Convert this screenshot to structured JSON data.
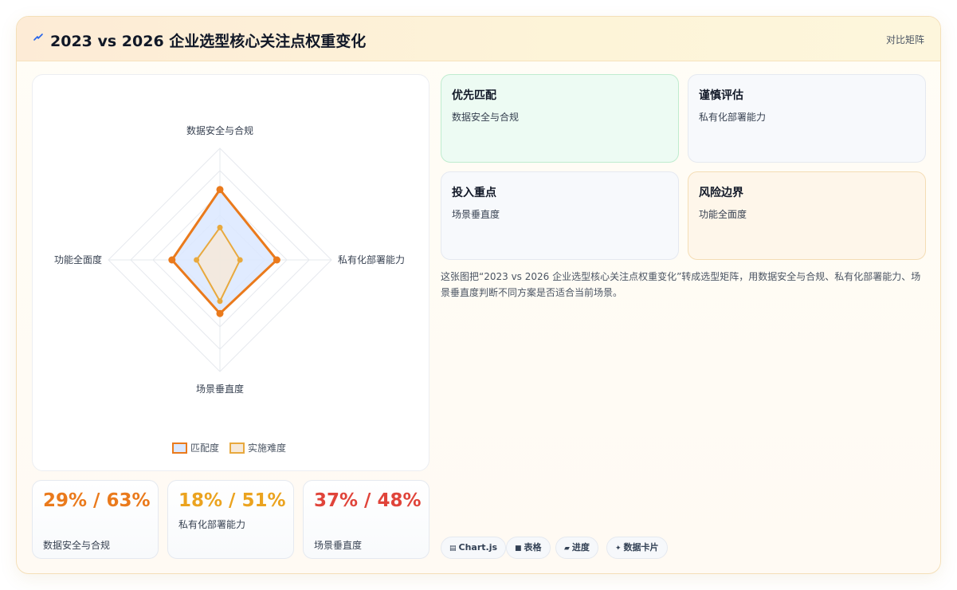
{
  "header": {
    "title": "2023 vs 2026 企业选型核心关注点权重变化",
    "badge": "对比矩阵",
    "icon": "lightning-icon",
    "accent": "#2563eb"
  },
  "chart_data": {
    "type": "radar",
    "title": "",
    "axes": [
      "数据安全与合规",
      "私有化部署能力",
      "场景垂直度",
      "功能全面度"
    ],
    "range": [
      0,
      100
    ],
    "grid": true,
    "legend_position": "bottom-center",
    "series": [
      {
        "name": "匹配度",
        "values": [
          63,
          51,
          48,
          43
        ],
        "color": "#ea7a1c",
        "fill": "#dbe8ff"
      },
      {
        "name": "实施难度",
        "values": [
          29,
          18,
          37,
          21
        ],
        "color": "#e8a93e",
        "fill": "#f6e9d9"
      }
    ]
  },
  "kpis": [
    {
      "value": "29% / 63%",
      "label": "数据安全与合规",
      "color": "#ea7a1c"
    },
    {
      "value": "18% / 51%",
      "label": "私有化部署能力",
      "color": "#eba31f"
    },
    {
      "value": "37% / 48%",
      "label": "场景垂直度",
      "color": "#e0443a"
    }
  ],
  "tiles": [
    {
      "title": "优先匹配",
      "sub": "数据安全与合规",
      "bg": "#edfbf3",
      "border": "#bfeccf"
    },
    {
      "title": "谨慎评估",
      "sub": "私有化部署能力",
      "bg": "#f7f9fc",
      "border": "#e5e9f0"
    },
    {
      "title": "投入重点",
      "sub": "场景垂直度",
      "bg": "#f7f9fc",
      "border": "#e5e9f0"
    },
    {
      "title": "风险边界",
      "sub": "功能全面度",
      "bg": "#fef6ea",
      "border": "#f4ddb5"
    }
  ],
  "description": "这张图把“2023 vs 2026 企业选型核心关注点权重变化”转成选型矩阵，用数据安全与合规、私有化部署能力、场景垂直度判断不同方案是否适合当前场景。",
  "tags": [
    {
      "icon": "chart-icon",
      "glyph": "▤",
      "label": "Chart.js"
    },
    {
      "icon": "table-icon",
      "glyph": "■",
      "label": "表格"
    },
    {
      "icon": "progress-icon",
      "glyph": "▰",
      "label": "进度"
    },
    {
      "icon": "sparkle-icon",
      "glyph": "✦",
      "label": "数据卡片"
    }
  ]
}
